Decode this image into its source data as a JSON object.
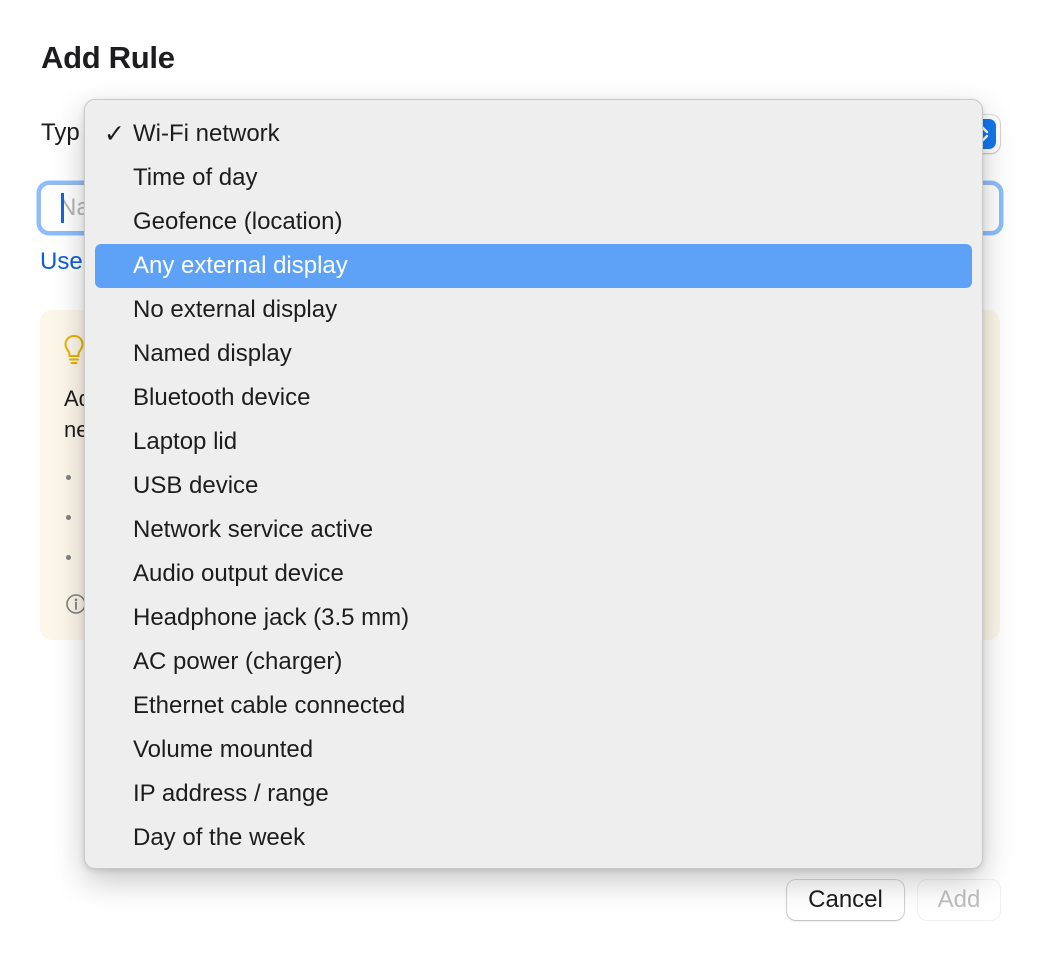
{
  "dialog": {
    "title": "Add Rule",
    "type_label": "Typ",
    "name_placeholder": "Na",
    "use_link": "Use",
    "accent_color": "#1478f0"
  },
  "tip_panel": {
    "icon": "lightbulb-icon",
    "text_line1": "Ad",
    "text_line2": "ne",
    "info_icon": "info-icon"
  },
  "menu": {
    "selected_value": "Wi-Fi network",
    "highlighted_value": "Any external display",
    "highlight_color": "#5ea2f8",
    "items": [
      "Wi-Fi network",
      "Time of day",
      "Geofence (location)",
      "Any external display",
      "No external display",
      "Named display",
      "Bluetooth device",
      "Laptop lid",
      "USB device",
      "Network service active",
      "Audio output device",
      "Headphone jack (3.5 mm)",
      "AC power (charger)",
      "Ethernet cable connected",
      "Volume mounted",
      "IP address / range",
      "Day of the week"
    ]
  },
  "buttons": {
    "cancel": "Cancel",
    "add": "Add"
  }
}
